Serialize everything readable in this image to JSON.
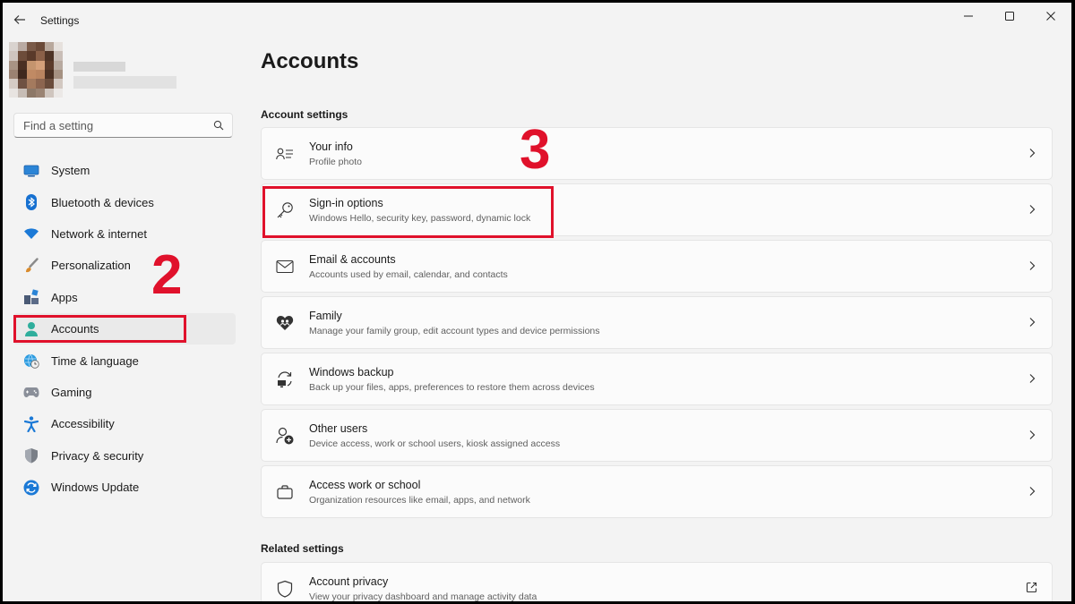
{
  "window": {
    "title": "Settings"
  },
  "search": {
    "placeholder": "Find a setting"
  },
  "sidebar": {
    "items": [
      {
        "label": "System",
        "icon": "monitor-icon"
      },
      {
        "label": "Bluetooth & devices",
        "icon": "bluetooth-icon"
      },
      {
        "label": "Network & internet",
        "icon": "wifi-icon"
      },
      {
        "label": "Personalization",
        "icon": "brush-icon"
      },
      {
        "label": "Apps",
        "icon": "apps-icon"
      },
      {
        "label": "Accounts",
        "icon": "person-icon",
        "active": true
      },
      {
        "label": "Time & language",
        "icon": "globe-clock-icon"
      },
      {
        "label": "Gaming",
        "icon": "gamepad-icon"
      },
      {
        "label": "Accessibility",
        "icon": "accessibility-icon"
      },
      {
        "label": "Privacy & security",
        "icon": "shield-icon"
      },
      {
        "label": "Windows Update",
        "icon": "sync-icon"
      }
    ]
  },
  "main": {
    "title": "Accounts",
    "account_settings_title": "Account settings",
    "cards": [
      {
        "title": "Your info",
        "subtitle": "Profile photo",
        "icon": "person-card-icon"
      },
      {
        "title": "Sign-in options",
        "subtitle": "Windows Hello, security key, password, dynamic lock",
        "icon": "key-icon"
      },
      {
        "title": "Email & accounts",
        "subtitle": "Accounts used by email, calendar, and contacts",
        "icon": "mail-icon"
      },
      {
        "title": "Family",
        "subtitle": "Manage your family group, edit account types and device permissions",
        "icon": "heart-icon"
      },
      {
        "title": "Windows backup",
        "subtitle": "Back up your files, apps, preferences to restore them across devices",
        "icon": "backup-icon"
      },
      {
        "title": "Other users",
        "subtitle": "Device access, work or school users, kiosk assigned access",
        "icon": "add-user-icon"
      },
      {
        "title": "Access work or school",
        "subtitle": "Organization resources like email, apps, and network",
        "icon": "briefcase-icon"
      }
    ],
    "related_settings_title": "Related settings",
    "related_cards": [
      {
        "title": "Account privacy",
        "subtitle": "View your privacy dashboard and manage activity data",
        "icon": "shield-outline-icon"
      }
    ]
  },
  "annotations": {
    "step2": "2",
    "step3": "3",
    "color": "#e0112b"
  },
  "colors": {
    "accent": "#0067c0",
    "window_bg": "#f3f3f3",
    "card_bg": "#fbfbfb"
  }
}
